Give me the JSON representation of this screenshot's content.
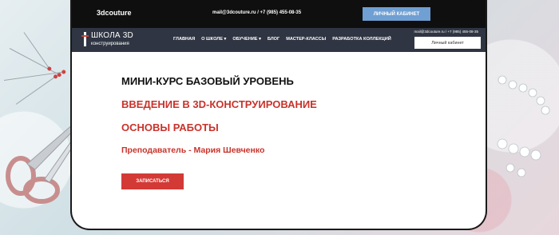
{
  "topbar": {
    "brand": "3dcouture",
    "contacts": "mail@3dcouture.ru / +7 (985) 455-08-35",
    "cabinet_button": "ЛИЧНЫЙ КАБИНЕТ"
  },
  "navbar": {
    "logo_title": "ШКОЛА 3D",
    "logo_sub_red": "",
    "logo_sub": "конструирования",
    "menu": [
      "ГЛАВНАЯ",
      "О ШКОЛЕ",
      "ОБУЧЕНИЕ",
      "БЛОГ",
      "МАСТЕР-КЛАССЫ",
      "РАЗРАБОТКА КОЛЛЕКЦИЙ"
    ],
    "menu_dropdown_marks": [
      "",
      "▾",
      "▾",
      "",
      "",
      ""
    ],
    "contacts": "mail@3dcouture.ru / +7 (985) 455-08-35",
    "cabinet_button": "Личный кабинет"
  },
  "hero": {
    "line1": "МИНИ-КУРС БАЗОВЫЙ УРОВЕНЬ",
    "line2": "ВВЕДЕНИЕ В 3D-КОНСТРУИРОВАНИЕ",
    "line3": "ОСНОВЫ РАБОТЫ",
    "teacher": "Преподаватель - Мария Шевченко",
    "signup_button": "ЗАПИСАТЬСЯ"
  },
  "colors": {
    "accent_red": "#c8332b",
    "button_red": "#d33a36",
    "nav_bg": "#2f3542",
    "top_btn_blue": "#6f9fd3"
  },
  "icons": {
    "scissors": "scissors-icon",
    "pins": "pin-icon",
    "beads": "beads-icon"
  }
}
